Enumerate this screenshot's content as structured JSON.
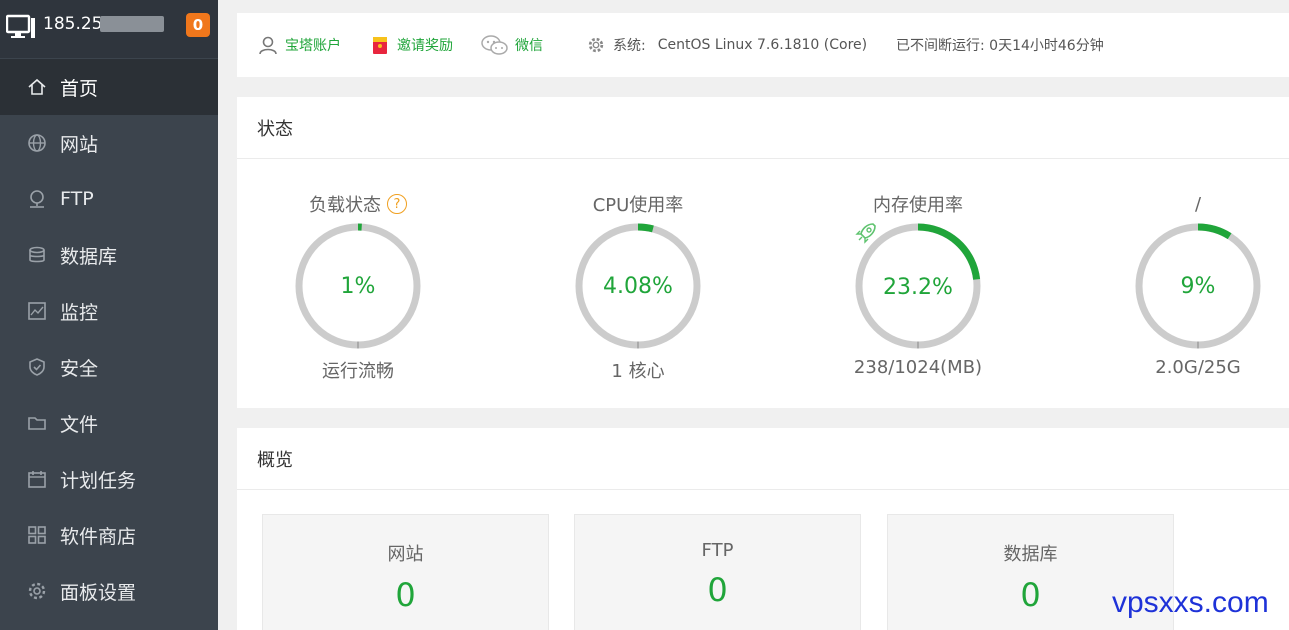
{
  "server": {
    "ip": "185.25.",
    "badge": "0"
  },
  "sidebar": {
    "items": [
      {
        "label": "首页",
        "icon": "home-icon",
        "active": true
      },
      {
        "label": "网站",
        "icon": "globe-icon"
      },
      {
        "label": "FTP",
        "icon": "ftp-icon"
      },
      {
        "label": "数据库",
        "icon": "database-icon"
      },
      {
        "label": "监控",
        "icon": "monitor-chart-icon"
      },
      {
        "label": "安全",
        "icon": "shield-icon"
      },
      {
        "label": "文件",
        "icon": "folder-icon"
      },
      {
        "label": "计划任务",
        "icon": "calendar-icon"
      },
      {
        "label": "软件商店",
        "icon": "grid-icon"
      },
      {
        "label": "面板设置",
        "icon": "gear-icon"
      }
    ]
  },
  "topbar": {
    "account": "宝塔账户",
    "invite": "邀请奖励",
    "wechat": "微信",
    "system_label": "系统:",
    "system_value": "CentOS Linux 7.6.1810 (Core)",
    "uptime": "已不间断运行: 0天14小时46分钟"
  },
  "status": {
    "title": "状态",
    "gauges": [
      {
        "title": "负载状态",
        "value": "1%",
        "fraction": 0.01,
        "sub": "运行流畅"
      },
      {
        "title": "CPU使用率",
        "value": "4.08%",
        "fraction": 0.0408,
        "sub": "1 核心"
      },
      {
        "title": "内存使用率",
        "value": "23.2%",
        "fraction": 0.232,
        "sub": "238/1024(MB)"
      },
      {
        "title": "/",
        "value": "9%",
        "fraction": 0.09,
        "sub": "2.0G/25G"
      }
    ]
  },
  "overview": {
    "title": "概览",
    "cards": [
      {
        "label": "网站",
        "value": "0"
      },
      {
        "label": "FTP",
        "value": "0"
      },
      {
        "label": "数据库",
        "value": "0"
      }
    ]
  },
  "watermark": "vpsxxs.com",
  "colors": {
    "accent": "#20a53a",
    "sidebar": "#3c444d",
    "badge": "#f0771c",
    "ring_track": "#cccccc"
  }
}
